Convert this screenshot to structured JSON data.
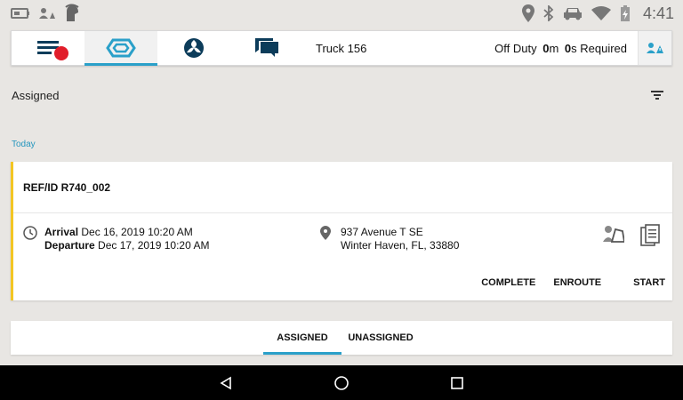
{
  "status_bar": {
    "time": "4:41"
  },
  "toolbar": {
    "title": "Truck 156",
    "duty_prefix": "Off Duty ",
    "duty_minutes": "0",
    "duty_m": "m ",
    "duty_seconds": "0",
    "duty_suffix": "s Required"
  },
  "section": {
    "title": "Assigned",
    "group": "Today"
  },
  "card": {
    "ref": "REF/ID R740_002",
    "arrival_label": "Arrival",
    "arrival_value": " Dec 16, 2019 10:20 AM",
    "departure_label": "Departure",
    "departure_value": " Dec 17, 2019 10:20 AM",
    "address_line1": "937 Avenue T SE",
    "address_line2": "Winter Haven, FL, 33880",
    "actions": {
      "complete": "COMPLETE",
      "enroute": "ENROUTE",
      "start": "START"
    }
  },
  "bottom_tabs": {
    "assigned": "ASSIGNED",
    "unassigned": "UNASSIGNED"
  },
  "colors": {
    "accent": "#2aa0c9",
    "alert_dot": "#e11d2a",
    "card_marker": "#f3c623",
    "toolbar_icon": "#0c3c5a"
  }
}
